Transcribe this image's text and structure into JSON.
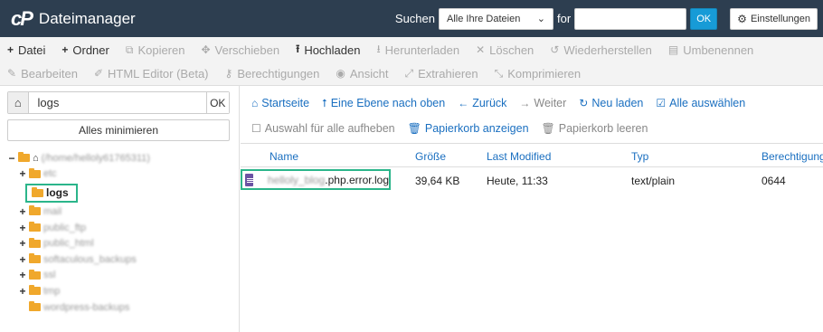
{
  "header": {
    "logo_text": "cP",
    "title": "Dateimanager",
    "search_label": "Suchen",
    "search_scope": "Alle Ihre Dateien",
    "for_label": "for",
    "search_value": "",
    "search_ok": "OK",
    "settings_label": "Einstellungen"
  },
  "toolbar": {
    "row1": [
      {
        "label": "Datei",
        "icon": "plus-icon",
        "glyph": "+",
        "active": true
      },
      {
        "label": "Ordner",
        "icon": "plus-icon",
        "glyph": "+",
        "active": true
      },
      {
        "label": "Kopieren",
        "icon": "copy-icon",
        "glyph": "⧉",
        "active": false
      },
      {
        "label": "Verschieben",
        "icon": "move-icon",
        "glyph": "✥",
        "active": false
      },
      {
        "label": "Hochladen",
        "icon": "upload-icon",
        "glyph": "⭱",
        "active": true
      },
      {
        "label": "Herunterladen",
        "icon": "download-icon",
        "glyph": "⭳",
        "active": false
      },
      {
        "label": "Löschen",
        "icon": "close-icon",
        "glyph": "✕",
        "active": false
      },
      {
        "label": "Wiederherstellen",
        "icon": "undo-icon",
        "glyph": "↺",
        "active": false
      },
      {
        "label": "Umbenennen",
        "icon": "file-icon",
        "glyph": "▤",
        "active": false
      }
    ],
    "row2": [
      {
        "label": "Bearbeiten",
        "icon": "pencil-icon",
        "glyph": "✎",
        "active": false
      },
      {
        "label": "HTML Editor (Beta)",
        "icon": "edit-icon",
        "glyph": "✐",
        "active": false
      },
      {
        "label": "Berechtigungen",
        "icon": "key-icon",
        "glyph": "⚷",
        "active": false
      },
      {
        "label": "Ansicht",
        "icon": "eye-icon",
        "glyph": "◉",
        "active": false
      },
      {
        "label": "Extrahieren",
        "icon": "expand-icon",
        "glyph": "⤢",
        "active": false
      },
      {
        "label": "Komprimieren",
        "icon": "compress-icon",
        "glyph": "⤡",
        "active": false
      }
    ]
  },
  "left": {
    "path_value": "logs",
    "path_ok": "OK",
    "collapse_all": "Alles minimieren",
    "tree": {
      "root_label": "(/home/helloly61765311)",
      "items": [
        {
          "label": "etc",
          "expandable": true,
          "blurred": true
        },
        {
          "label": "logs",
          "expandable": false,
          "blurred": false,
          "selected": true
        },
        {
          "label": "mail",
          "expandable": true,
          "blurred": true
        },
        {
          "label": "public_ftp",
          "expandable": true,
          "blurred": true
        },
        {
          "label": "public_html",
          "expandable": true,
          "blurred": true
        },
        {
          "label": "softaculous_backups",
          "expandable": true,
          "blurred": true
        },
        {
          "label": "ssl",
          "expandable": true,
          "blurred": true
        },
        {
          "label": "tmp",
          "expandable": true,
          "blurred": true
        },
        {
          "label": "wordpress-backups",
          "expandable": false,
          "blurred": true
        }
      ]
    }
  },
  "actions": {
    "row1": [
      {
        "label": "Startseite",
        "icon": "home-icon",
        "glyph": "⌂",
        "enabled": true
      },
      {
        "label": "Eine Ebene nach oben",
        "icon": "level-up-icon",
        "glyph": "⭡",
        "enabled": true
      },
      {
        "label": "Zurück",
        "icon": "arrow-left-icon",
        "glyph": "←",
        "enabled": true
      },
      {
        "label": "Weiter",
        "icon": "arrow-right-icon",
        "glyph": "→",
        "enabled": false
      },
      {
        "label": "Neu laden",
        "icon": "refresh-icon",
        "glyph": "↻",
        "enabled": true
      },
      {
        "label": "Alle auswählen",
        "icon": "check-square-icon",
        "glyph": "☑",
        "enabled": true
      }
    ],
    "row2": [
      {
        "label": "Auswahl für alle aufheben",
        "icon": "square-icon",
        "glyph": "☐",
        "enabled": false
      },
      {
        "label": "Papierkorb anzeigen",
        "icon": "trash-icon",
        "glyph": "🗑",
        "enabled": true
      },
      {
        "label": "Papierkorb leeren",
        "icon": "trash-icon",
        "glyph": "🗑",
        "enabled": false
      }
    ]
  },
  "table": {
    "headers": {
      "name": "Name",
      "size": "Größe",
      "modified": "Last Modified",
      "type": "Typ",
      "perms": "Berechtigungen"
    },
    "rows": [
      {
        "name_blur": "helloly_blog",
        "name_rest": ".php.error.log",
        "size": "39,64 KB",
        "modified": "Heute, 11:33",
        "type": "text/plain",
        "perms": "0644"
      }
    ]
  },
  "colors": {
    "header_bg": "#2d3e50",
    "link": "#1a6fc0",
    "highlight": "#2bb58a",
    "folder": "#f0a82c",
    "ok_blue": "#179bd7"
  }
}
